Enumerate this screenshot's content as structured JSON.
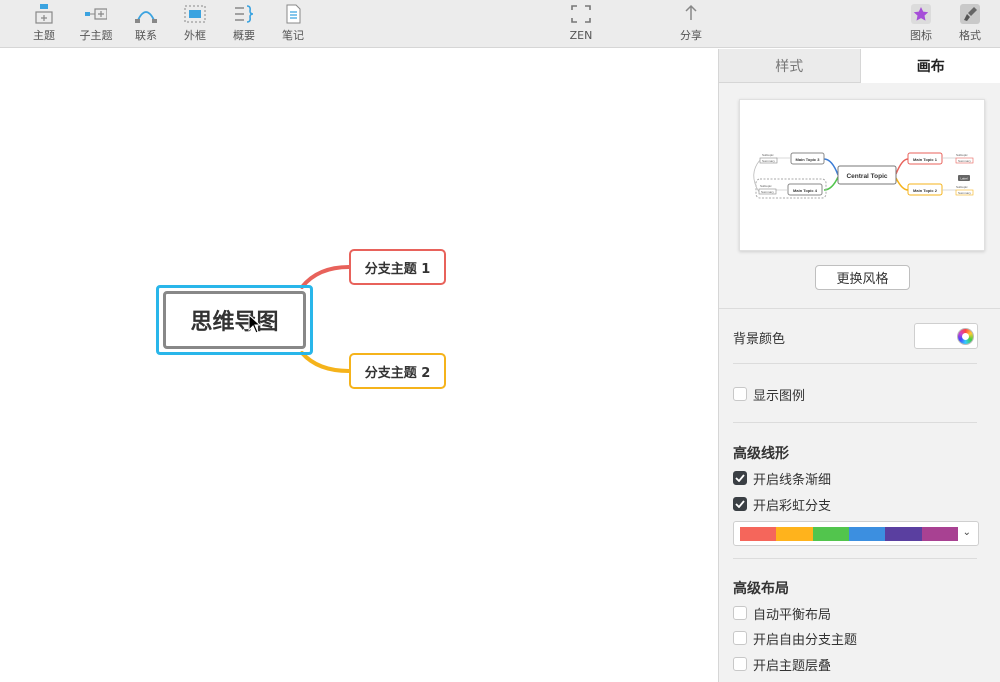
{
  "toolbar": {
    "items": [
      {
        "label": "主题",
        "icon": "topic-icon"
      },
      {
        "label": "子主题",
        "icon": "subtopic-icon"
      },
      {
        "label": "联系",
        "icon": "relationship-icon"
      },
      {
        "label": "外框",
        "icon": "boundary-icon"
      },
      {
        "label": "概要",
        "icon": "summary-icon"
      },
      {
        "label": "笔记",
        "icon": "notes-icon"
      }
    ],
    "zen": "ZEN",
    "share": "分享",
    "icons": "图标",
    "format": "格式"
  },
  "canvas": {
    "central_topic": "思维导图",
    "branches": [
      "分支主题 1",
      "分支主题 2"
    ],
    "branch_colors": [
      "#e8625b",
      "#f5b31b"
    ],
    "selection_color": "#29b6ea"
  },
  "panel": {
    "tabs": [
      "样式",
      "画布"
    ],
    "active_tab": "画布",
    "preview": {
      "central": "Central Topic",
      "main_topics": [
        "Main Topic 1",
        "Main Topic 2",
        "Main Topic 3",
        "Main Topic 4"
      ],
      "subtopic_label": "Subtopic",
      "summary_label": "Summary",
      "label_tag": "Label"
    },
    "change_style_button": "更换风格",
    "background_color_label": "背景颜色",
    "background_color": "#ffffff",
    "show_legend_label": "显示图例",
    "show_legend": false,
    "advanced_line_title": "高级线形",
    "taper_lines_label": "开启线条渐细",
    "taper_lines": true,
    "rainbow_branch_label": "开启彩虹分支",
    "rainbow_branch": true,
    "rainbow_colors": [
      "#f5665b",
      "#ffb31c",
      "#52c54d",
      "#3c8fe0",
      "#5a3fa0",
      "#a84192"
    ],
    "advanced_layout_title": "高级布局",
    "auto_balance_label": "自动平衡布局",
    "auto_balance": false,
    "free_branch_label": "开启自由分支主题",
    "free_branch": false,
    "topic_overlap_label": "开启主题层叠",
    "topic_overlap": false
  }
}
